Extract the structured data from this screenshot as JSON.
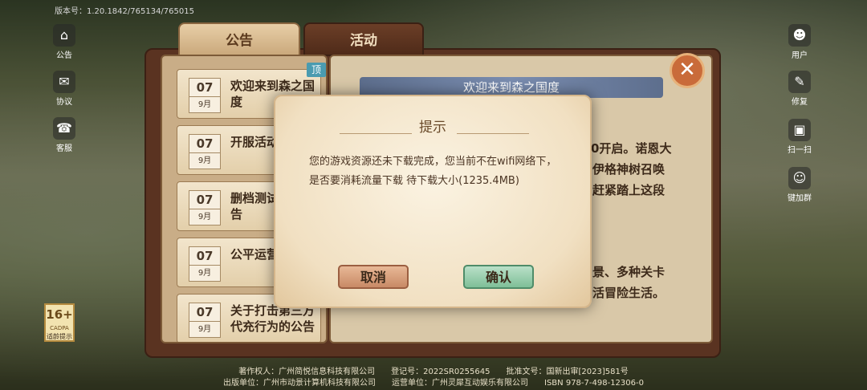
{
  "version": "版本号：1.20.1842/765134/765015",
  "left_sidebar": [
    {
      "icon": "notice-icon",
      "glyph": "⌂",
      "label": "公告"
    },
    {
      "icon": "agreement-icon",
      "glyph": "✉",
      "label": "协议"
    },
    {
      "icon": "support-icon",
      "glyph": "☎",
      "label": "客服"
    }
  ],
  "right_sidebar": [
    {
      "icon": "user-icon",
      "glyph": "☻",
      "label": "用户"
    },
    {
      "icon": "repair-icon",
      "glyph": "✎",
      "label": "修复"
    },
    {
      "icon": "scan-icon",
      "glyph": "▣",
      "label": "扫一扫"
    },
    {
      "icon": "join-group-icon",
      "glyph": "☺",
      "label": "键加群"
    }
  ],
  "tabs": {
    "notice": "公告",
    "event": "活动"
  },
  "notice_list": [
    {
      "day": "07",
      "month": "9月",
      "title": "欢迎来到森之国度",
      "pinned_badge": "顶"
    },
    {
      "day": "07",
      "month": "9月",
      "title": "开服活动"
    },
    {
      "day": "07",
      "month": "9月",
      "title": "删档测试返利公告"
    },
    {
      "day": "07",
      "month": "9月",
      "title": "公平运营"
    },
    {
      "day": "07",
      "month": "9月",
      "title": "关于打击第三方代充行为的公告"
    }
  ],
  "content": {
    "title": "欢迎来到森之国度",
    "line1": "0开启。诺恩大",
    "line2": "伊格神树召唤",
    "line3": "赶紧踏上这段",
    "line4": "景、多种关卡",
    "line5": "活冒险生活。"
  },
  "dialog": {
    "title": "提示",
    "message": "您的游戏资源还未下载完成，您当前不在wifi网络下，是否要消耗流量下载 待下载大小(1235.4MB)",
    "cancel": "取消",
    "confirm": "确认"
  },
  "age_badge": {
    "rating": "16+",
    "sub": "CADPA",
    "label": "适龄提示"
  },
  "footer": {
    "line1": "著作权人：广州简悦信息科技有限公司　　登记号：2022SR0255645　　批准文号：国新出审[2023]581号",
    "line2": "出版单位：广州市动景计算机科技有限公司　　运营单位：广州灵犀互动娱乐有限公司　　ISBN 978-7-498-12306-0"
  }
}
